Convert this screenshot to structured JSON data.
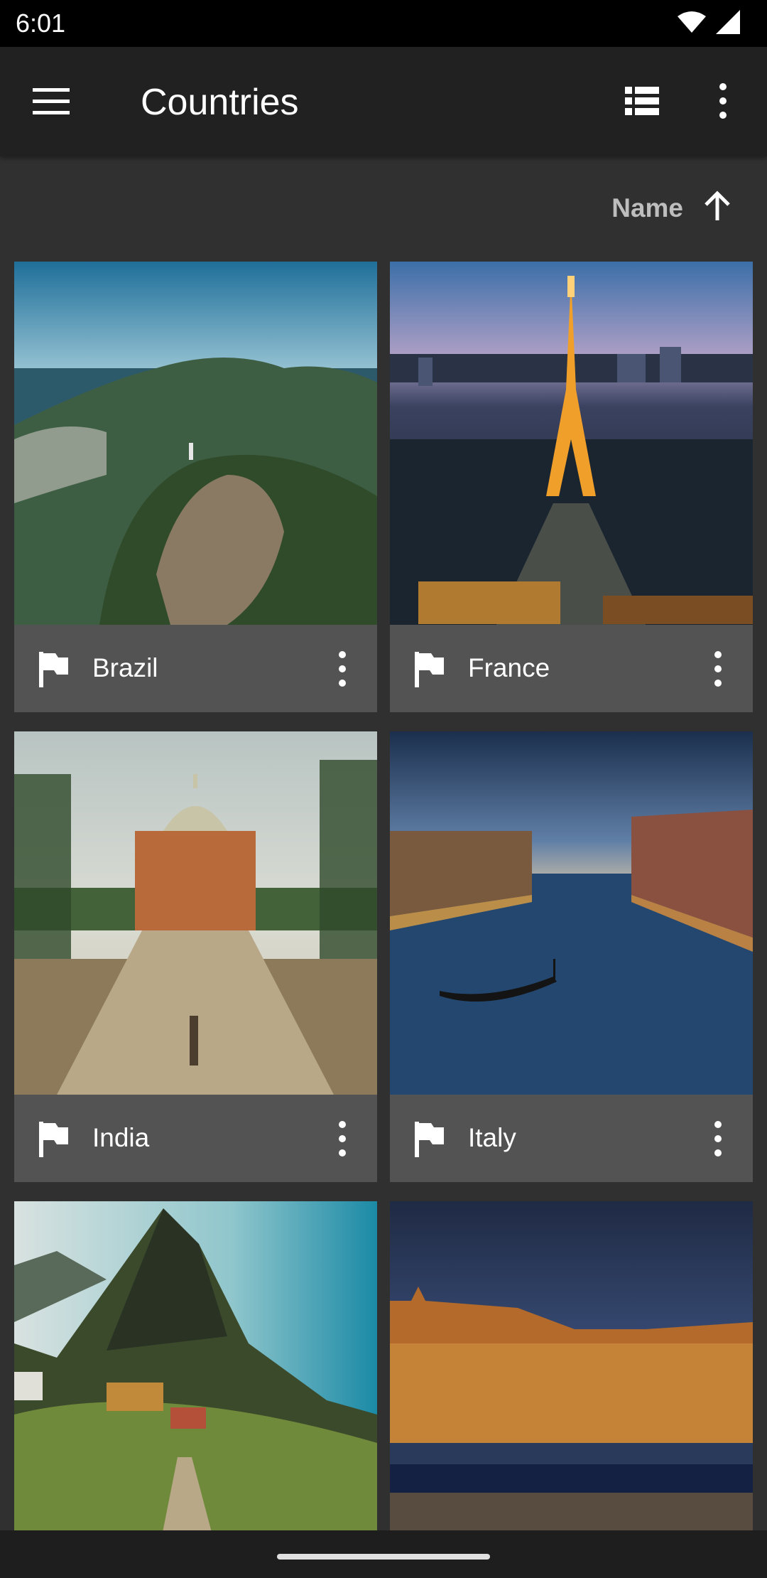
{
  "status_bar": {
    "time": "6:01",
    "icons": [
      "wifi-icon",
      "cell-signal-icon"
    ]
  },
  "app_bar": {
    "title": "Countries",
    "menu_icon": "hamburger-menu-icon",
    "view_toggle_icon": "list-view-icon",
    "overflow_icon": "more-vert-icon"
  },
  "sort": {
    "label": "Name",
    "direction_icon": "arrow-up-icon"
  },
  "countries": [
    {
      "name": "Brazil",
      "image": "rio-de-janeiro-aerial-photo"
    },
    {
      "name": "France",
      "image": "paris-eiffel-tower-night-photo"
    },
    {
      "name": "India",
      "image": "tomb-with-palm-trees-photo"
    },
    {
      "name": "Italy",
      "image": "venice-grand-canal-dusk-photo"
    },
    {
      "name": "",
      "image": "mountain-village-boardwalk-photo"
    },
    {
      "name": "",
      "image": "riverside-old-town-night-photo"
    }
  ],
  "colors": {
    "status_bar": "#000000",
    "app_bar": "#212121",
    "background": "#303030",
    "card_footer": "#535353",
    "text": "#ffffff",
    "sort_label": "#bdbdbd"
  }
}
